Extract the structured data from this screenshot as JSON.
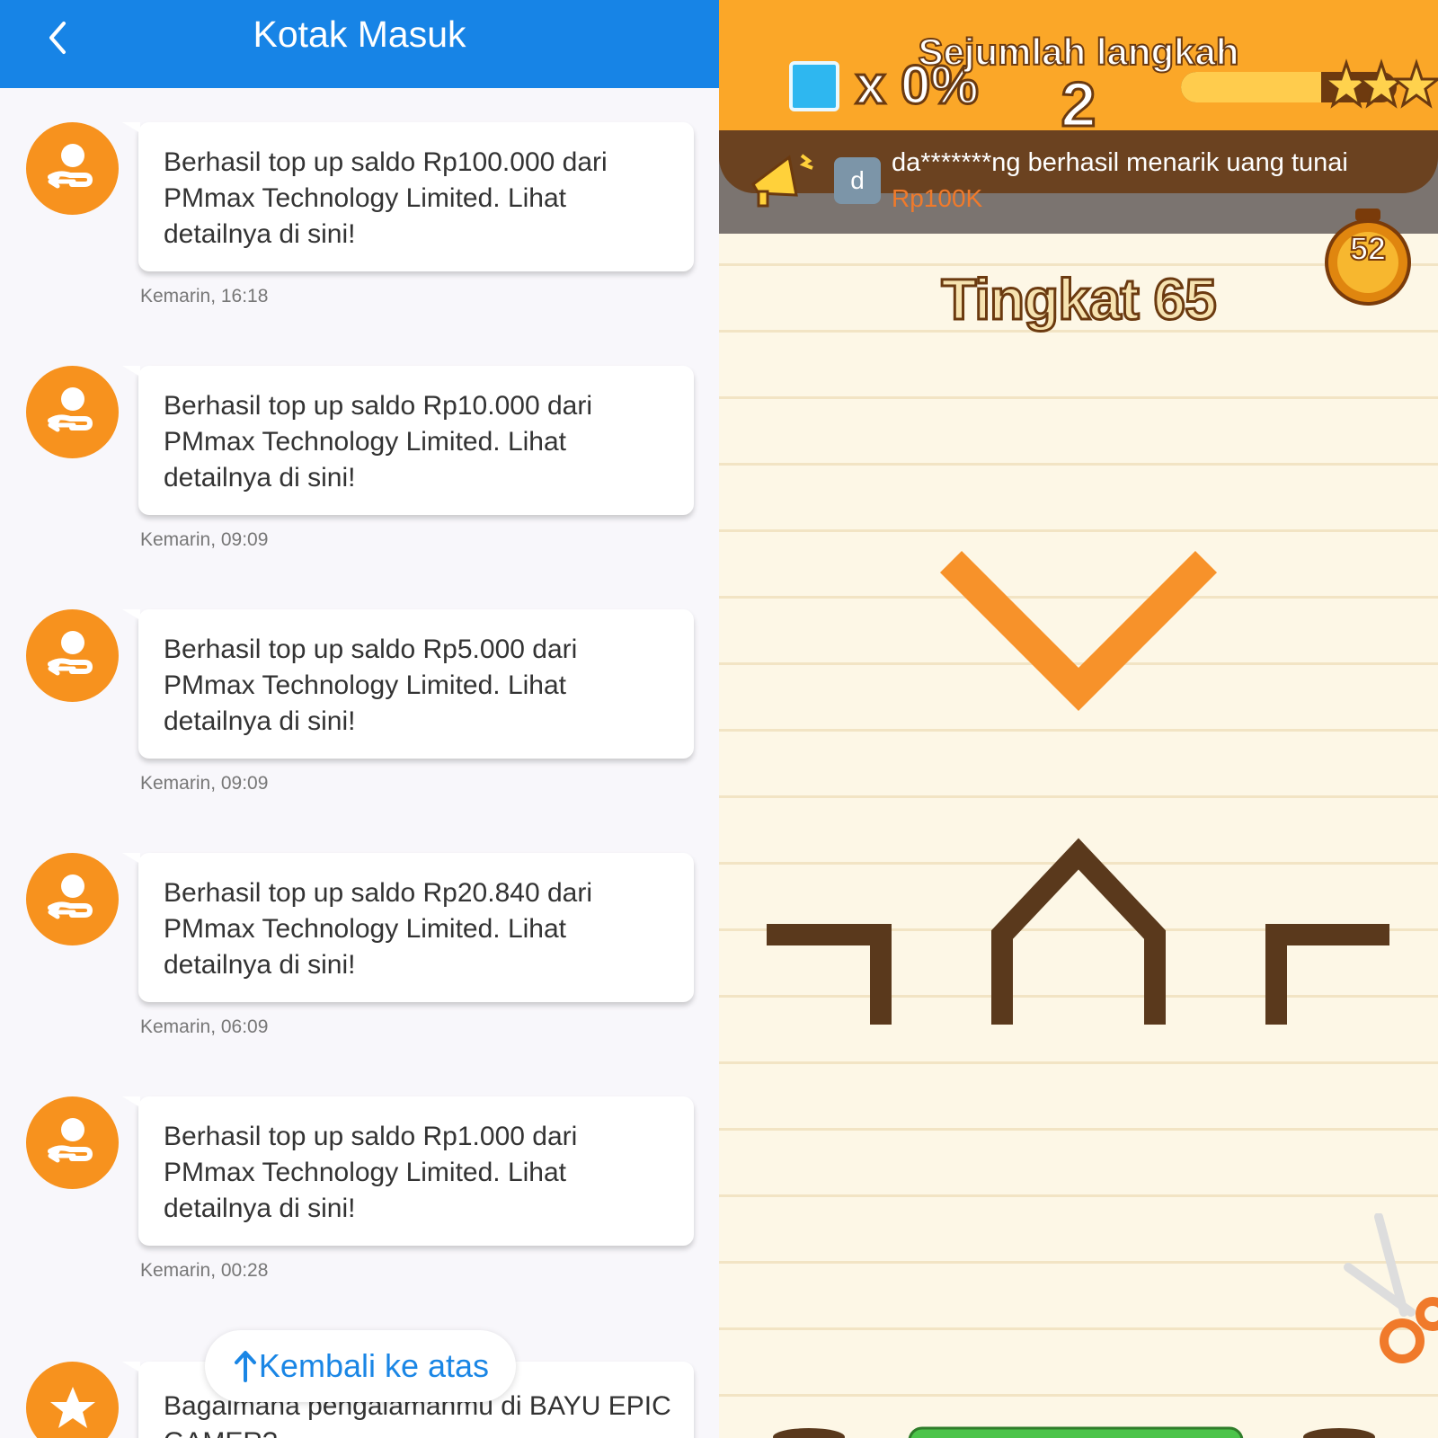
{
  "inbox": {
    "title": "Kotak Masuk",
    "messages": [
      {
        "text": "Berhasil top up saldo Rp100.000 dari PMmax Technology Limited. Lihat detailnya di sini!",
        "time": "Kemarin, 16:18"
      },
      {
        "text": "Berhasil top up saldo Rp10.000 dari PMmax Technology Limited. Lihat detailnya di sini!",
        "time": "Kemarin, 09:09"
      },
      {
        "text": "Berhasil top up saldo Rp5.000 dari PMmax Technology Limited. Lihat detailnya di sini!",
        "time": "Kemarin, 09:09"
      },
      {
        "text": "Berhasil top up saldo Rp20.840 dari PMmax Technology Limited. Lihat detailnya di sini!",
        "time": "Kemarin, 06:09"
      },
      {
        "text": "Berhasil top up saldo Rp1.000 dari PMmax Technology Limited. Lihat detailnya di sini!",
        "time": "Kemarin, 00:28"
      }
    ],
    "last_message_text": "Bagaimana pengalamanmu di BAYU EPIC GAMER?",
    "scroll_top_label": "Kembali ke atas",
    "icons": {
      "back": "chevron-left-icon",
      "message_avatar": "transfer-hand-icon",
      "rating_avatar": "star-icon",
      "scroll_top": "arrow-up-icon"
    },
    "colors": {
      "header": "#1784e6",
      "avatar": "#f7921e",
      "link": "#1a86e5"
    }
  },
  "game": {
    "multiplier": "x 0%",
    "steps_label": "Sejumlah langkah",
    "steps_value": "2",
    "progress": 0.65,
    "notice_avatar_letter": "d",
    "notice_text": "da*******ng berhasil menarik uang tunai",
    "notice_amount": "Rp100K",
    "timer_value": "52",
    "level_title": "Tingkat 65",
    "icons": {
      "megaphone": "megaphone-icon",
      "timer": "stopwatch-icon",
      "tool": "scissors-icon",
      "water": "water-tile-icon",
      "stars": "star-rating-icon"
    },
    "colors": {
      "top_bar": "#fba728",
      "shape_active": "#f7922a",
      "shape_lines": "#5a391c"
    }
  }
}
